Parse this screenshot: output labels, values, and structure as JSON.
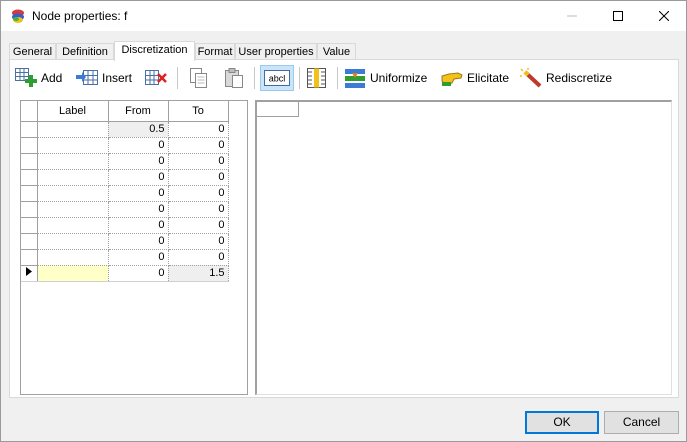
{
  "window": {
    "title": "Node properties: f"
  },
  "tabs": [
    {
      "label": "General",
      "active": false
    },
    {
      "label": "Definition",
      "active": false
    },
    {
      "label": "Discretization",
      "active": true
    },
    {
      "label": "Format",
      "active": false
    },
    {
      "label": "User properties",
      "active": false
    },
    {
      "label": "Value",
      "active": false
    }
  ],
  "toolbar": {
    "add_label": "Add",
    "insert_label": "Insert",
    "uniformize_label": "Uniformize",
    "elicitate_label": "Elicitate",
    "rediscretize_label": "Rediscretize",
    "text_mode_icon_text": "abcl"
  },
  "grid": {
    "columns": [
      "Label",
      "From",
      "To"
    ],
    "rows": [
      {
        "label": "",
        "from": "0.5",
        "to": "0"
      },
      {
        "label": "",
        "from": "0",
        "to": "0"
      },
      {
        "label": "",
        "from": "0",
        "to": "0"
      },
      {
        "label": "",
        "from": "0",
        "to": "0"
      },
      {
        "label": "",
        "from": "0",
        "to": "0"
      },
      {
        "label": "",
        "from": "0",
        "to": "0"
      },
      {
        "label": "",
        "from": "0",
        "to": "0"
      },
      {
        "label": "",
        "from": "0",
        "to": "0"
      },
      {
        "label": "",
        "from": "0",
        "to": "0"
      },
      {
        "label": "",
        "from": "0",
        "to": "1.5"
      }
    ],
    "current_row": 9
  },
  "buttons": {
    "ok_label": "OK",
    "cancel_label": "Cancel"
  },
  "colors": {
    "accent": "#0078d7",
    "selected_cell": "#ffffc8"
  }
}
